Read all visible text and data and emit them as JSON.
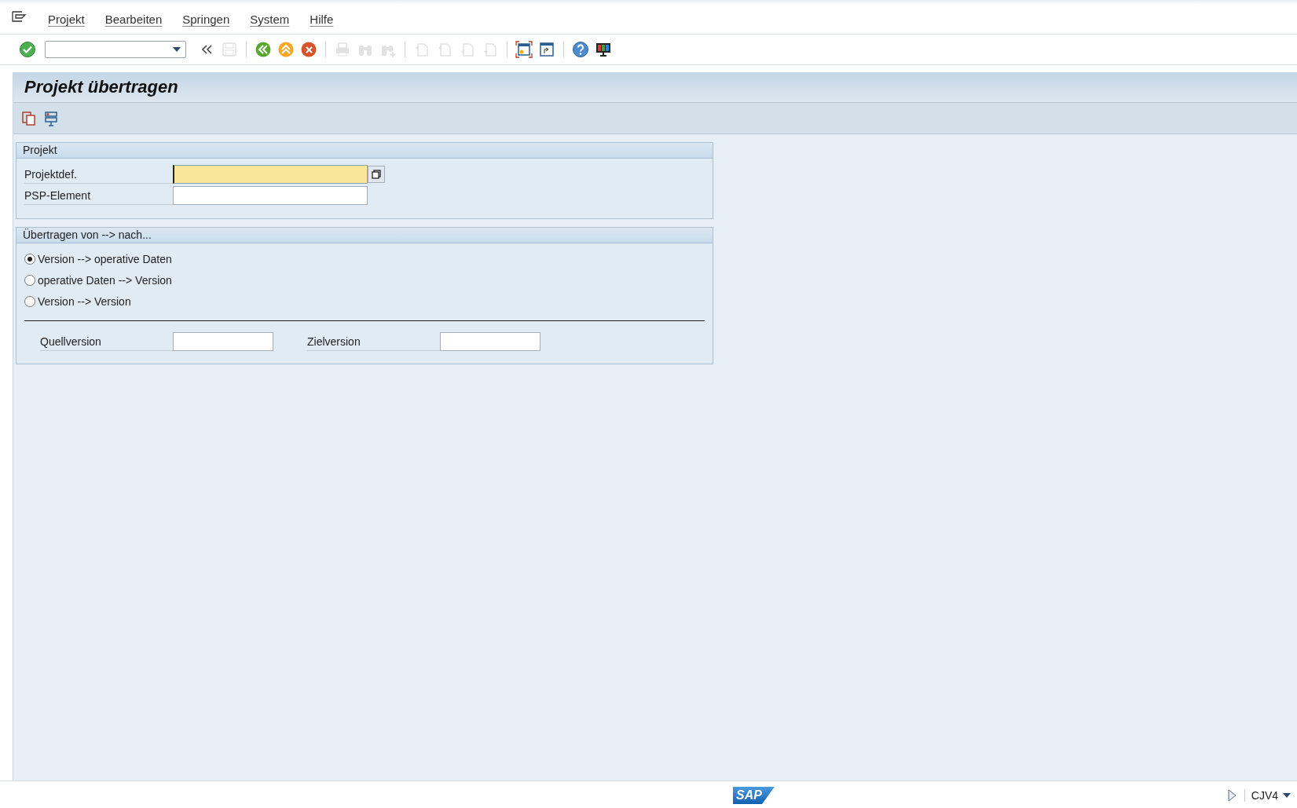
{
  "menu": [
    {
      "label": "Projekt"
    },
    {
      "label": "Bearbeiten"
    },
    {
      "label": "Springen"
    },
    {
      "label": "System"
    },
    {
      "label": "Hilfe"
    }
  ],
  "toolbar": [
    {
      "kind": "enter",
      "disabled": false
    },
    {
      "kind": "command",
      "disabled": false
    },
    {
      "kind": "collapse",
      "disabled": false
    },
    {
      "kind": "save",
      "disabled": true
    },
    {
      "kind": "separator"
    },
    {
      "kind": "back",
      "disabled": false
    },
    {
      "kind": "exit",
      "disabled": false
    },
    {
      "kind": "cancel",
      "disabled": false
    },
    {
      "kind": "separator"
    },
    {
      "kind": "print",
      "disabled": true
    },
    {
      "kind": "find",
      "disabled": true
    },
    {
      "kind": "find-next",
      "disabled": true
    },
    {
      "kind": "separator"
    },
    {
      "kind": "first-page",
      "disabled": true
    },
    {
      "kind": "prev-page",
      "disabled": true
    },
    {
      "kind": "next-page",
      "disabled": true
    },
    {
      "kind": "last-page",
      "disabled": true
    },
    {
      "kind": "separator"
    },
    {
      "kind": "new-session",
      "disabled": false,
      "selected": true
    },
    {
      "kind": "shortcut",
      "disabled": false,
      "selected": false
    },
    {
      "kind": "separator"
    },
    {
      "kind": "help",
      "disabled": false
    },
    {
      "kind": "layout",
      "disabled": false
    }
  ],
  "title": "Projekt übertragen",
  "app_toolbar": [
    {
      "kind": "copy"
    },
    {
      "kind": "structure"
    }
  ],
  "group_project": {
    "title": "Projekt",
    "fields": [
      {
        "label": "Projektdef.",
        "focused": true,
        "value_help": true
      },
      {
        "label": "PSP-Element",
        "focused": false,
        "value_help": false
      }
    ]
  },
  "group_transfer": {
    "title": "Übertragen von --> nach...",
    "options": [
      {
        "label": "Version --> operative Daten",
        "selected": true
      },
      {
        "label": "operative Daten --> Version",
        "selected": false
      },
      {
        "label": "Version --> Version",
        "selected": false
      }
    ],
    "fields": [
      {
        "label": "Quellversion"
      },
      {
        "label": "Zielversion"
      }
    ]
  },
  "status_bar": {
    "logo": "SAP",
    "transaction": "CJV4"
  }
}
